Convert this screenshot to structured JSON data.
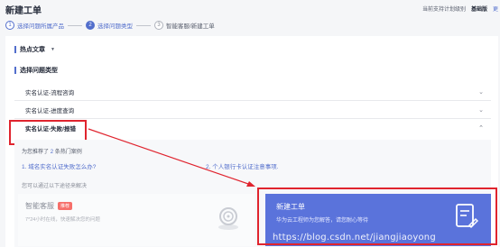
{
  "header": {
    "title": "新建工单",
    "support_text": "当前支持计划级别",
    "edition": "基础版",
    "more": "更"
  },
  "steps": [
    {
      "num": "1",
      "label": "选择问题所属产品"
    },
    {
      "num": "2",
      "label": "选择问题类型"
    },
    {
      "num": "3",
      "label": "智能客服/新建工单"
    }
  ],
  "hot_articles": {
    "label": "热点文章"
  },
  "question_type": {
    "label": "选择问题类型"
  },
  "questions": [
    {
      "label": "实名认证-流程咨询"
    },
    {
      "label": "实名认证-进度查询"
    },
    {
      "label": "实名认证-失败/报错"
    }
  ],
  "detail": {
    "recommend_prefix": "为您推荐了",
    "recommend_count": "2",
    "recommend_suffix": "条热门案例",
    "case1": "1. 域名实名认证失败怎么办?",
    "case2": "2. 个人银行卡认证注意事项.",
    "alt_text": "您可以通过以下途径来解决"
  },
  "smart_service": {
    "title": "智能客服",
    "badge": "推荐",
    "subtitle": "7*24小时在线，快速解决您的问题"
  },
  "new_ticket": {
    "title": "新建工单",
    "subtitle": "华为云工程师为您解答，请您耐心等待"
  },
  "watermark": "https://blog.csdn.net/jiangjiaoyong",
  "colors": {
    "accent": "#526ecc",
    "ticket_bg": "#5a73db",
    "highlight": "#e0242e",
    "badge": "#f66f6a"
  }
}
